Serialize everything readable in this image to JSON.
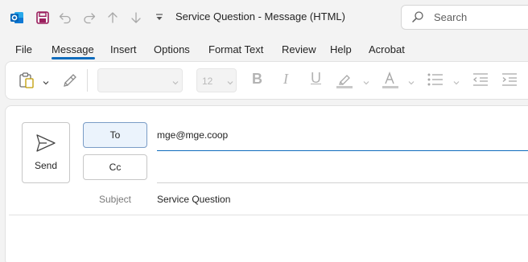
{
  "titlebar": {
    "title": "Service Question  -  Message (HTML)",
    "search_placeholder": "Search",
    "icons": [
      "outlook-icon",
      "save-icon",
      "undo-icon",
      "redo-icon",
      "up-arrow-icon",
      "down-arrow-icon",
      "customize-toolbar-icon",
      "search-icon"
    ]
  },
  "menu": {
    "items": [
      "File",
      "Message",
      "Insert",
      "Options",
      "Format Text",
      "Review",
      "Help",
      "Acrobat"
    ],
    "active": "Message"
  },
  "ribbon": {
    "font_name": "",
    "font_size": "12",
    "bold_glyph": "B",
    "italic_glyph": "I",
    "underline_glyph": "U",
    "icons": [
      "paste-icon",
      "format-painter-icon",
      "highlight-icon",
      "font-color-icon",
      "bullets-icon",
      "decrease-indent-icon",
      "increase-indent-icon"
    ]
  },
  "compose": {
    "send_label": "Send",
    "to_label": "To",
    "cc_label": "Cc",
    "to_value": "mge@mge.coop",
    "cc_value": "",
    "subject_label": "Subject",
    "subject_value": "Service Question"
  },
  "colors": {
    "accent": "#0f6cbd",
    "outlook_blue": "#0f78d4",
    "save_purple": "#9b1f5e",
    "to_button_bg": "#ebf3fc"
  }
}
